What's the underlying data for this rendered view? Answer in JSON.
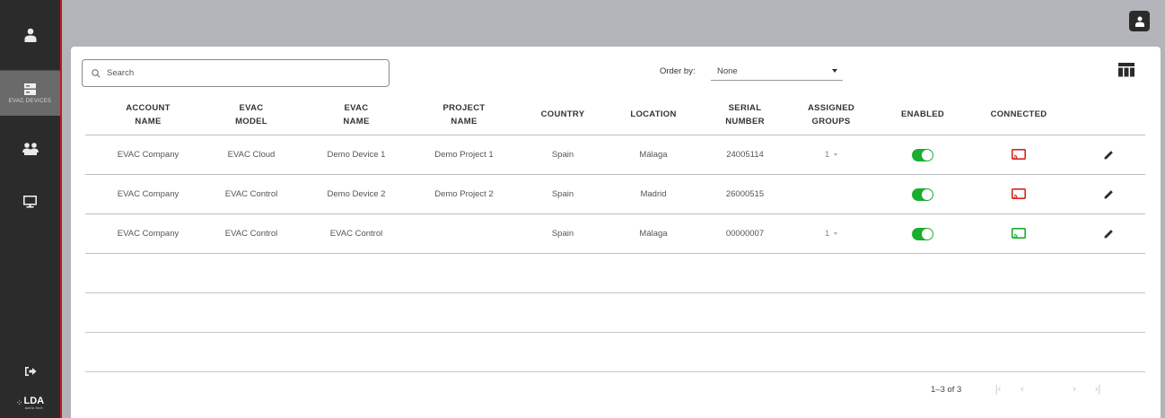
{
  "sidebar": {
    "items": [
      {
        "name": "user-icon",
        "label": ""
      },
      {
        "name": "devices-icon",
        "label": "EVAC DEVICES"
      },
      {
        "name": "group-icon",
        "label": ""
      },
      {
        "name": "monitor-icon",
        "label": ""
      }
    ],
    "logout_icon": "logout-icon",
    "logo_text": "LDA",
    "logo_sub": "audio tech"
  },
  "header": {
    "user_icon": "account-icon"
  },
  "search": {
    "placeholder": "Search",
    "value": ""
  },
  "order_by": {
    "label": "Order by:",
    "selected": "None"
  },
  "table": {
    "headers": [
      {
        "l1": "ACCOUNT",
        "l2": "NAME"
      },
      {
        "l1": "EVAC",
        "l2": "MODEL"
      },
      {
        "l1": "EVAC",
        "l2": "NAME"
      },
      {
        "l1": "PROJECT",
        "l2": "NAME"
      },
      {
        "l1": "COUNTRY",
        "l2": ""
      },
      {
        "l1": "LOCATION",
        "l2": ""
      },
      {
        "l1": "SERIAL",
        "l2": "NUMBER"
      },
      {
        "l1": "ASSIGNED",
        "l2": "GROUPS"
      },
      {
        "l1": "ENABLED",
        "l2": ""
      },
      {
        "l1": "CONNECTED",
        "l2": ""
      }
    ],
    "rows": [
      {
        "account": "EVAC Company",
        "model": "EVAC Cloud",
        "name": "Demo Device 1",
        "project": "Demo Project 1",
        "country": "Spain",
        "location": "Málaga",
        "serial": "24005114",
        "groups": "1",
        "enabled": true,
        "connected": false
      },
      {
        "account": "EVAC Company",
        "model": "EVAC Control",
        "name": "Demo Device 2",
        "project": "Demo Project 2",
        "country": "Spain",
        "location": "Madrid",
        "serial": "26000515",
        "groups": "",
        "enabled": true,
        "connected": false
      },
      {
        "account": "EVAC Company",
        "model": "EVAC Control",
        "name": "EVAC Control",
        "project": "",
        "country": "Spain",
        "location": "Málaga",
        "serial": "00000007",
        "groups": "1",
        "enabled": true,
        "connected": true
      }
    ]
  },
  "pagination": {
    "range": "1–3 of 3"
  },
  "colors": {
    "accent_red": "#c8161d",
    "enabled_green": "#1aae2e",
    "connected_green": "#1aae2e",
    "disconnected_red": "#d9251c",
    "sidebar_bg": "#2b2b2b"
  }
}
